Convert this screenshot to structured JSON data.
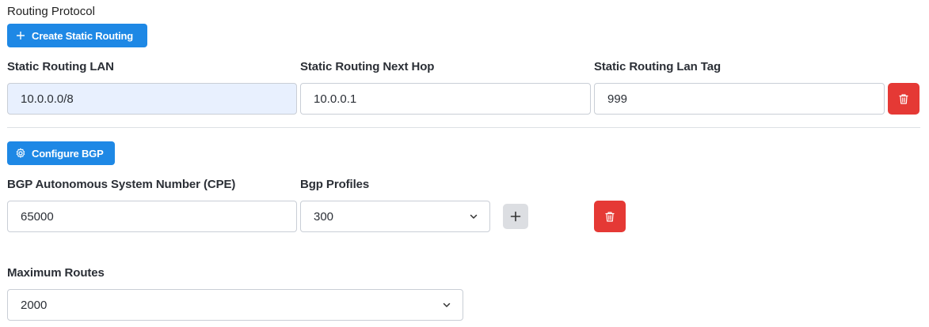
{
  "routing": {
    "title": "Routing Protocol",
    "create_static_label": "Create Static Routing",
    "lan_label": "Static Routing LAN",
    "next_hop_label": "Static Routing Next Hop",
    "lan_tag_label": "Static Routing Lan Tag",
    "lan_value": "10.0.0.0/8",
    "next_hop_value": "10.0.0.1",
    "lan_tag_value": "999"
  },
  "bgp": {
    "configure_label": "Configure BGP",
    "asn_label": "BGP Autonomous System Number (CPE)",
    "profiles_label": "Bgp Profiles",
    "asn_value": "65000",
    "profile_selected": "300",
    "max_routes_label": "Maximum Routes",
    "max_routes_selected": "2000"
  },
  "icons": {
    "plus": "plus-icon",
    "gear": "gear-icon",
    "trash": "trash-icon",
    "chevron": "chevron-down-icon"
  },
  "colors": {
    "primary": "#1e88e5",
    "danger": "#e53935",
    "filled_bg": "#e8f0fe"
  }
}
